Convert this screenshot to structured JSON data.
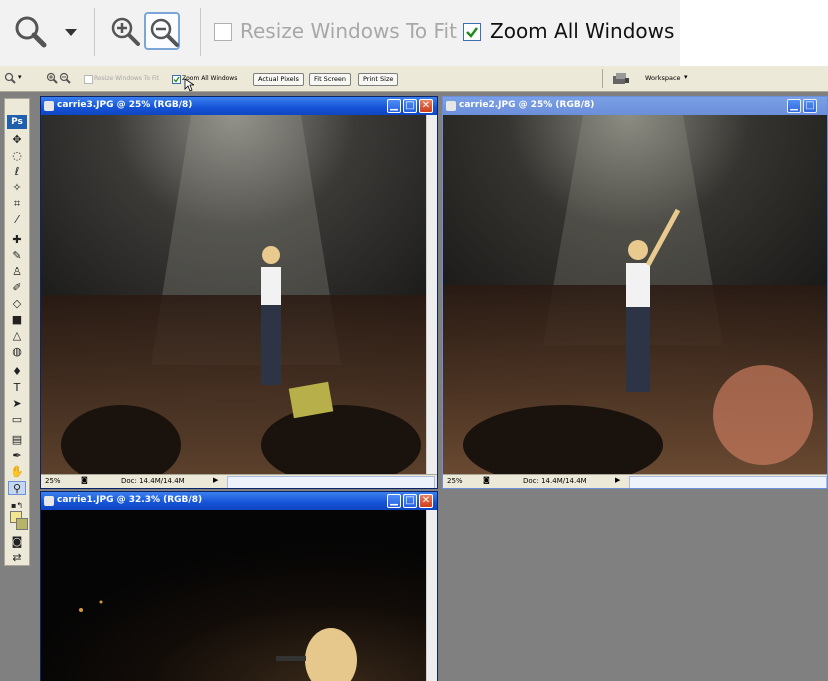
{
  "zoom_bar": {
    "resize_label": "Resize Windows To Fit",
    "zoom_all_label": "Zoom All Windows",
    "resize_checked": false,
    "zoom_all_checked": true
  },
  "options_bar": {
    "resize_label": "Resize Windows To Fit",
    "zoom_all_label": "Zoom All Windows",
    "actual_pixels": "Actual Pixels",
    "fit_screen": "Fit Screen",
    "print_size": "Print Size",
    "workspace": "Workspace"
  },
  "toolbox": {
    "logo": "Ps"
  },
  "windows": [
    {
      "title": "carrie3.JPG @ 25% (RGB/8)",
      "zoom": "25%",
      "doc": "Doc: 14.4M/14.4M",
      "active": true
    },
    {
      "title": "carrie2.JPG @ 25% (RGB/8)",
      "zoom": "25%",
      "doc": "Doc: 14.4M/14.4M",
      "active": false
    },
    {
      "title": "carrie1.JPG @ 32.3% (RGB/8)",
      "active": true
    }
  ],
  "colors": {
    "title_active": "#1553d6",
    "title_inactive": "#6b8fd8",
    "workspace_bg": "#808080",
    "checkbox_check": "#1f8a1f"
  }
}
